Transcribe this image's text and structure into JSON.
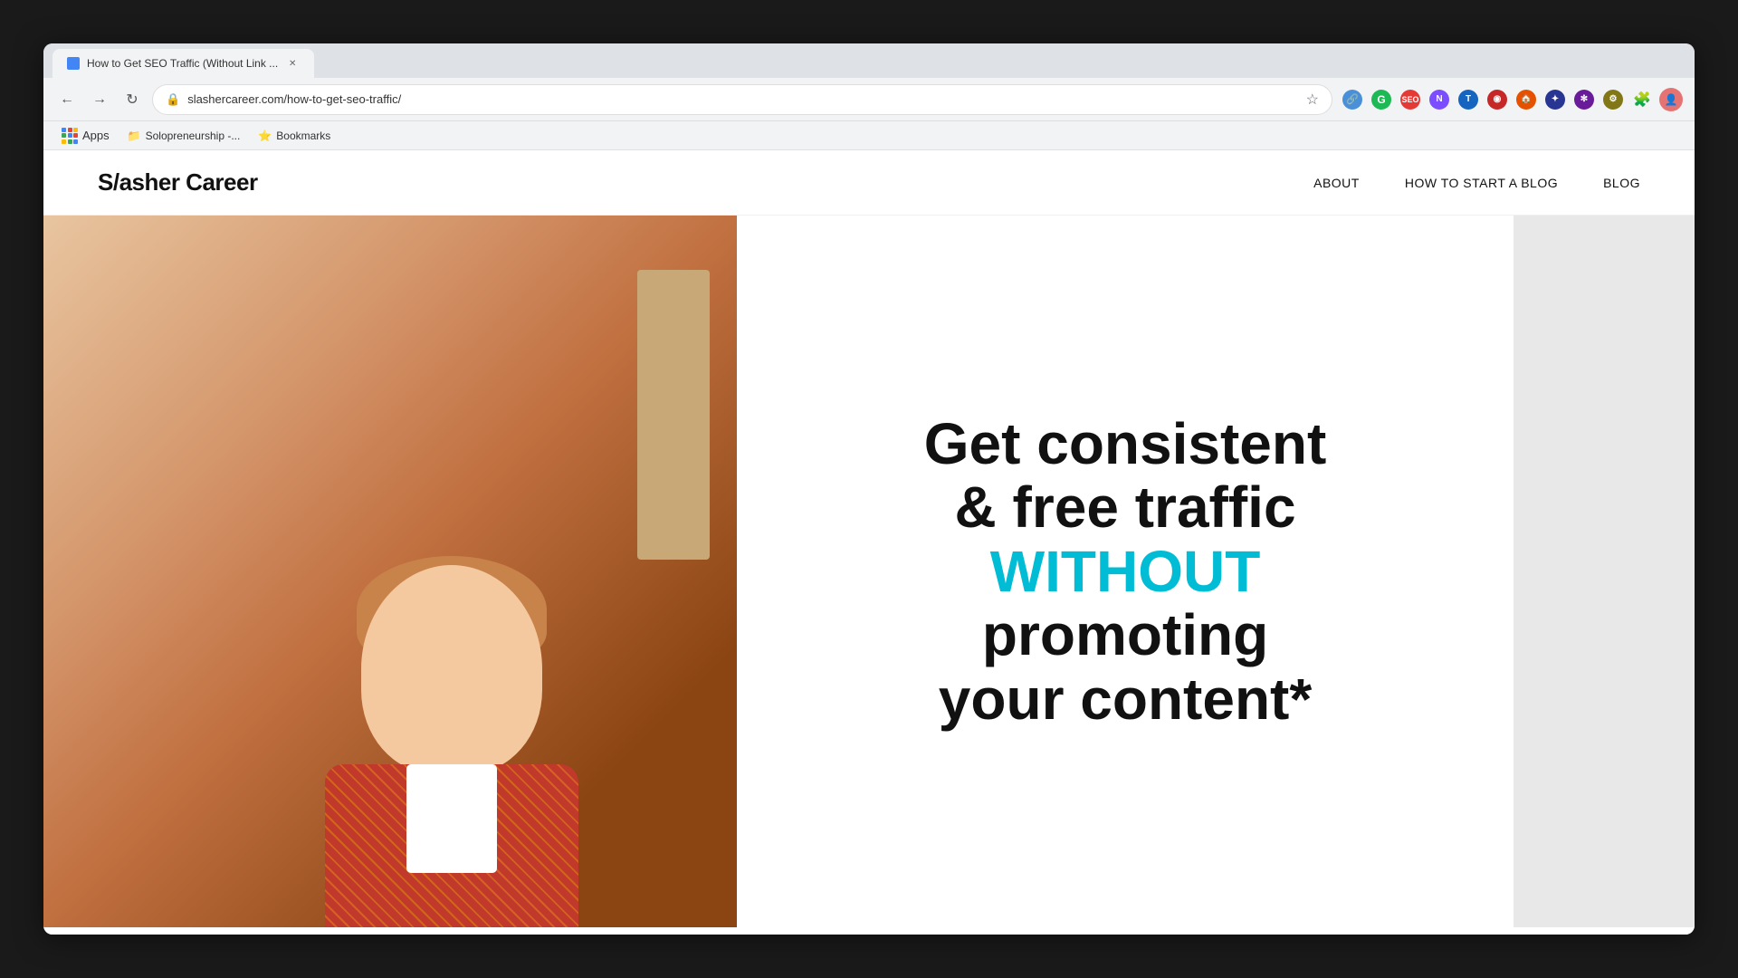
{
  "browser": {
    "tab_label": "How to Get SEO Traffic (Without Link ...",
    "url": "slashercareer.com/how-to-get-seo-traffic/",
    "bookmarks": [
      {
        "label": "Solopreneurship -...",
        "icon": "folder"
      },
      {
        "label": "Bookmarks",
        "icon": "star"
      }
    ],
    "apps_label": "Apps",
    "extensions": [
      {
        "color": "#4a90d9",
        "label": "link-icon"
      },
      {
        "color": "#1db954",
        "label": "grammarly-icon"
      },
      {
        "color": "#e53935",
        "label": "seo-icon"
      },
      {
        "color": "#7c4dff",
        "label": "extension-4-icon"
      },
      {
        "color": "#1565c0",
        "label": "extension-5-icon"
      },
      {
        "color": "#c62828",
        "label": "extension-6-icon"
      },
      {
        "color": "#e65100",
        "label": "extension-7-icon"
      },
      {
        "color": "#283593",
        "label": "extension-8-icon"
      },
      {
        "color": "#6a1b9a",
        "label": "extension-9-icon"
      },
      {
        "color": "#827717",
        "label": "extension-10-icon"
      },
      {
        "color": "#555",
        "label": "puzzle-icon"
      }
    ]
  },
  "site": {
    "logo": "S/asher Career",
    "nav": [
      {
        "label": "ABOUT"
      },
      {
        "label": "HOW TO START A BLOG"
      },
      {
        "label": "BLOG"
      }
    ]
  },
  "hero": {
    "line1": "Get consistent",
    "line2": "& free traffic",
    "line3_highlight": "WITHOUT",
    "line4": "promoting",
    "line5": "your content*",
    "highlight_color": "#00bcd4"
  }
}
